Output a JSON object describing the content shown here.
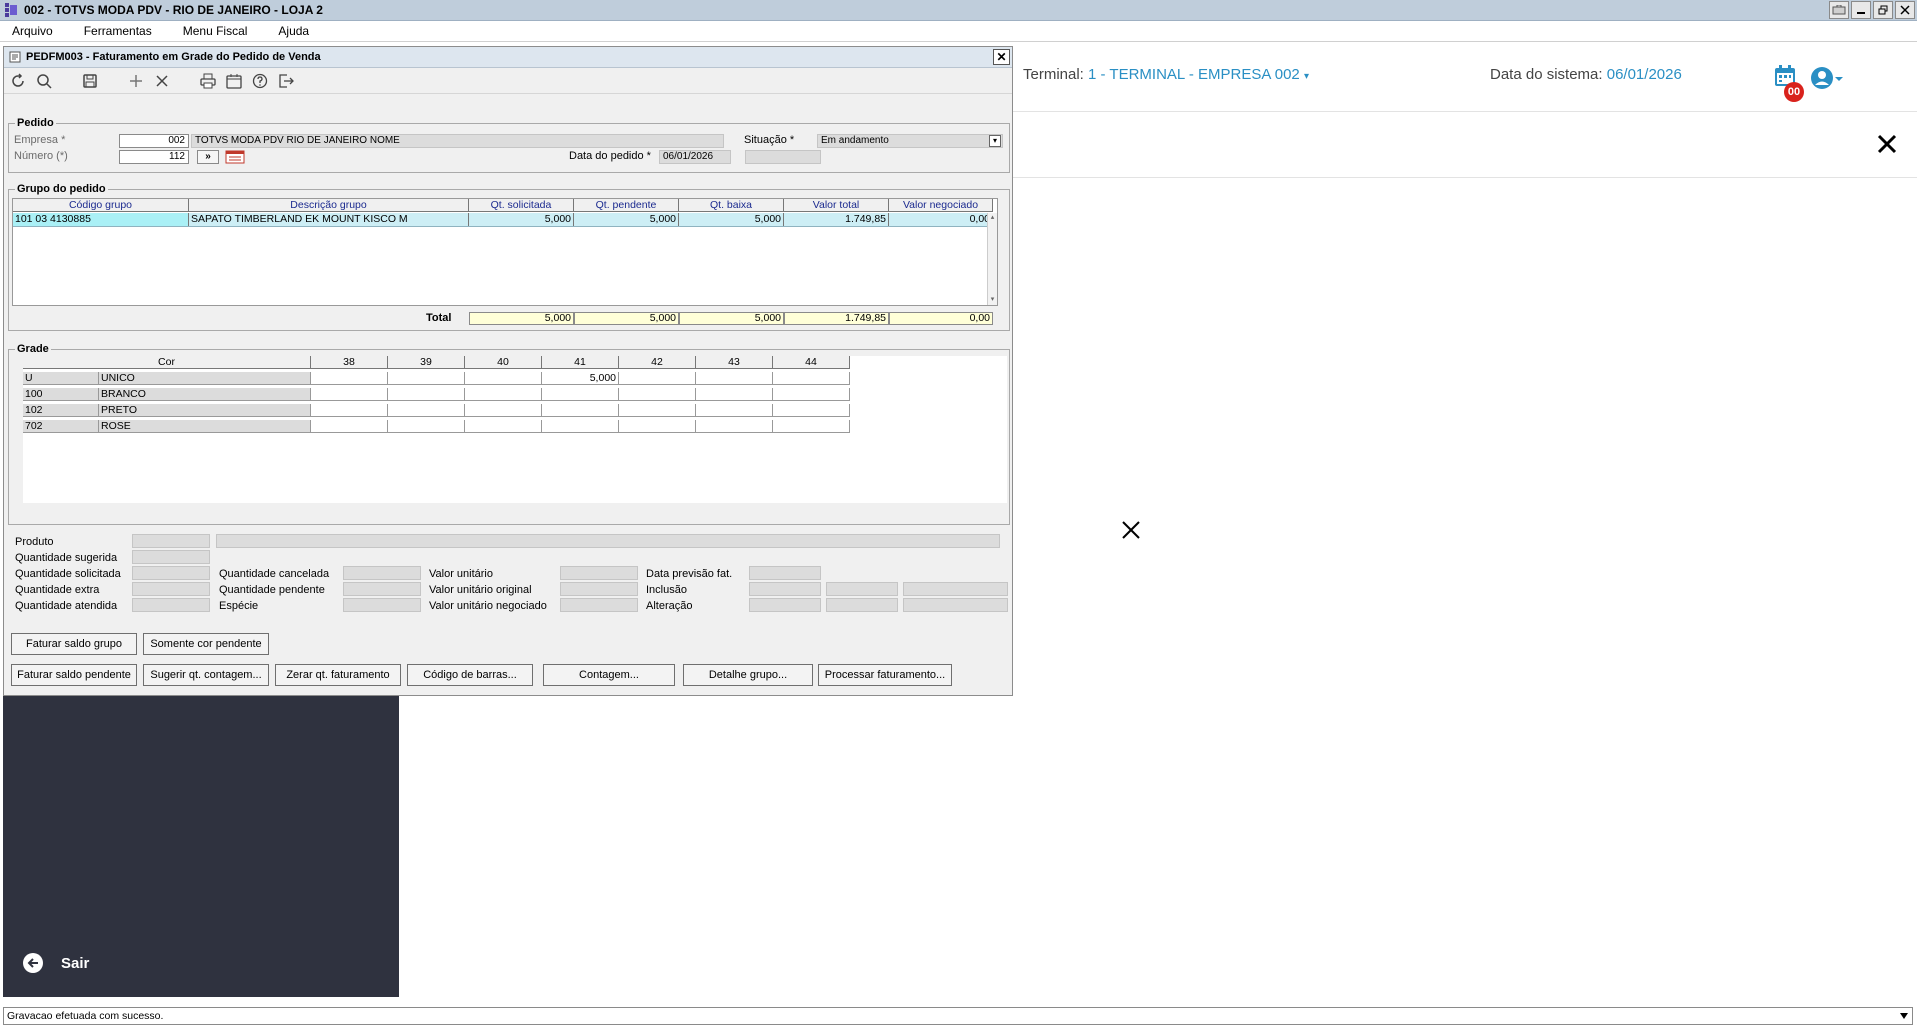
{
  "app": {
    "title": "002 - TOTVS MODA PDV - RIO DE JANEIRO - LOJA 2"
  },
  "menu": [
    "Arquivo",
    "Ferramentas",
    "Menu Fiscal",
    "Ajuda"
  ],
  "dialog": {
    "title": "PEDFM003 - Faturamento em Grade do Pedido de Venda",
    "pedido": {
      "legend": "Pedido",
      "empresa_label": "Empresa *",
      "empresa_code": "002",
      "empresa_name": "TOTVS MODA PDV   RIO DE JANEIRO   NOME",
      "numero_label": "Número (*)",
      "numero_value": "112",
      "nav_label": "»",
      "situacao_label": "Situação *",
      "situacao_value": "Em andamento",
      "data_label": "Data do pedido *",
      "data_value": "06/01/2026"
    },
    "grupo": {
      "legend": "Grupo do pedido",
      "columns": [
        "Código grupo",
        "Descrição grupo",
        "Qt. solicitada",
        "Qt. pendente",
        "Qt. baixa",
        "Valor total",
        "Valor  negociado"
      ],
      "row": [
        "101 03 4130885",
        "SAPATO TIMBERLAND EK MOUNT KISCO M",
        "5,000",
        "5,000",
        "5,000",
        "1.749,85",
        "0,00"
      ],
      "total_label": "Total",
      "totals": [
        "5,000",
        "5,000",
        "5,000",
        "1.749,85",
        "0,00"
      ]
    },
    "grade": {
      "legend": "Grade",
      "cor_header": "Cor",
      "sizes": [
        "38",
        "39",
        "40",
        "41",
        "42",
        "43",
        "44"
      ],
      "rows": [
        {
          "code": "U",
          "name": "UNICO",
          "values": [
            "",
            "",
            "",
            "5,000",
            "",
            "",
            ""
          ]
        },
        {
          "code": "100",
          "name": "BRANCO",
          "values": [
            "",
            "",
            "",
            "",
            "",
            "",
            ""
          ]
        },
        {
          "code": "102",
          "name": "PRETO",
          "values": [
            "",
            "",
            "",
            "",
            "",
            "",
            ""
          ]
        },
        {
          "code": "702",
          "name": "ROSE",
          "values": [
            "",
            "",
            "",
            "",
            "",
            "",
            ""
          ]
        }
      ]
    },
    "details": {
      "produto": "Produto",
      "qt_sugerida": "Quantidade sugerida",
      "qt_solicitada": "Quantidade solicitada",
      "qt_extra": "Quantidade extra",
      "qt_atendida": "Quantidade atendida",
      "qt_cancelada": "Quantidade cancelada",
      "qt_pendente": "Quantidade pendente",
      "especie": "Espécie",
      "valor_unitario": "Valor unitário",
      "valor_unitario_original": "Valor unitário original",
      "valor_unitario_negociado": "Valor unitário negociado",
      "data_previsao": "Data previsão fat.",
      "inclusao": "Inclusão",
      "alteracao": "Alteração"
    },
    "buttons": {
      "faturar_saldo_grupo": "Faturar saldo grupo",
      "somente_cor_pendente": "Somente cor pendente",
      "faturar_saldo_pendente": "Faturar saldo pendente",
      "sugerir_contagem": "Sugerir qt. contagem...",
      "zerar_faturamento": "Zerar qt. faturamento",
      "codigo_barras": "Código de barras...",
      "contagem": "Contagem...",
      "detalhe_grupo": "Detalhe grupo...",
      "processar_faturamento": "Processar faturamento..."
    }
  },
  "webpanel": {
    "terminal_label": "Terminal:",
    "terminal_value": "1 - TERMINAL - EMPRESA 002",
    "date_label": "Data do sistema:",
    "date_value": "06/01/2026",
    "badge": "00",
    "accent": "#2a8fc4",
    "badge_color": "#d9221c"
  },
  "sidebar": {
    "exit_label": "Sair",
    "bg": "#2f323f"
  },
  "status": {
    "message": "Gravacao efetuada com sucesso."
  }
}
